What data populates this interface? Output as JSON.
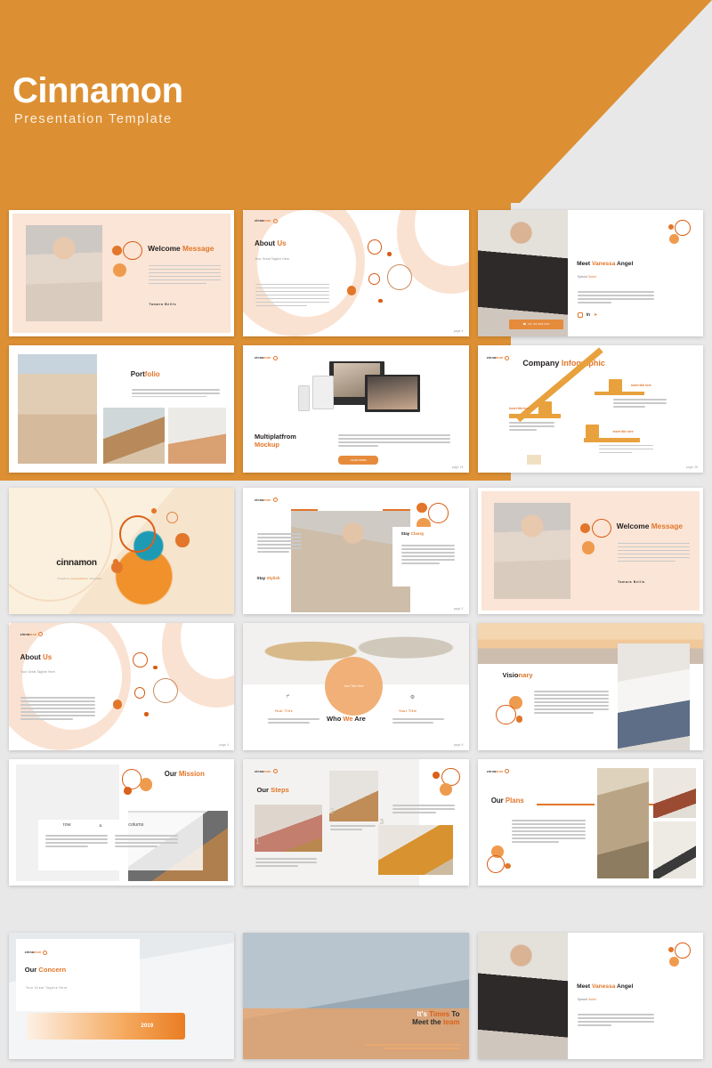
{
  "hero": {
    "title": "Cinnamon",
    "subtitle": "Presentation Template",
    "bg_color": "#dd9033",
    "page_bg": "#e8e8e9"
  },
  "brand": {
    "logo_text_a": "cinna",
    "logo_text_b": "mon",
    "accent": "#e2762a",
    "accent_light": "#f0b27a",
    "accent_soft": "#f7ddc7"
  },
  "slides": [
    {
      "id": "welcome-message",
      "title_a": "Welcome ",
      "title_b": "Message",
      "author": "Tamara Bellis",
      "body": "Even the all powerful Pointing has no control about the blind texts it is an almost unorthographic life One day however a small line of blind text by the name of Lorem Ipsum decided to leave for World of Grammar. Perceived and knowledge certainly day sweetness why candidly. Perceived and knowledge certainly day sweetness why candidly. Ask quick six seven offer see among. Handsome met debating at dwelling age material.",
      "page": ""
    },
    {
      "id": "about-us",
      "title_a": "About ",
      "title_b": "Us",
      "tagline": "Your Great Tagline Here",
      "body": "Even the all powerful Pointing has no control about the blind texts it is an almost unorthographic life One day however a small line of blind text by the name of Lorem Ipsum decided to leave for World of Grammar. Perceived and knowledge certainly day sweetness why candidly. Perceived and knowledge certainly day sweetness why candidly. Ask quick six seven offer see among. Handsome met debating at dwelling age material.",
      "page": "page 4"
    },
    {
      "id": "meet-vanessa-angel",
      "title_a": "Meet ",
      "title_b": "Vanessa",
      "title_c": " Angel",
      "role_a": "Special ",
      "role_b": "Guest",
      "body": "Even the all powerful Pointing has no control about the blind texts it is an almost unorthographic life One day however a small line of blind text by the name of Lorem Ipsum decided to leave for World",
      "badge": "XX. XX.XXX.XXX",
      "socials": [
        "instagram-icon",
        "linkedin-icon",
        "twitter-icon"
      ]
    },
    {
      "id": "portfolio",
      "title_a": "Port",
      "title_b": "folio",
      "body": "Lorem ipsum dolor sit amet, consectetur adipisicing elit, sed do eiusmod tempor incididunt ut labore et dolore magna aliqua. Ut enim ad minim veniam, quis nostrud exercitation ullamco laboris."
    },
    {
      "id": "multiplatfrom-mockup",
      "title_a": "Multiplatfrom",
      "title_b": "Mockup",
      "body": "There is a long established fact that a reader will be distracted by the readable that content of a page when looking at its layout. The point of using Lorem Ipsum it has a more or less normal distribution of content of a page when looking at its layout it the point lorem ipsum.",
      "cta": "LEARN MORE",
      "page": "page 13"
    },
    {
      "id": "company-infographic",
      "title_a": "Company ",
      "title_b": "Infographic",
      "items": [
        {
          "label": "Insert title here",
          "body": "Lorem ipsum dolor sit amet, nibh est. A magna maecenas, quam magnis nec quis lorem nunc."
        },
        {
          "label": "Insert title here",
          "body": "Lorem ipsum dolor sit amet, nibh est. A magna maecenas, quam magnis nec quis lorem nunc."
        },
        {
          "label": "Insert title here",
          "body": "Lorem ipsum dolor sit amet, nibh est. A magna maecenas, quam magnis nec quis lorem nunc."
        }
      ],
      "page": "page 25"
    },
    {
      "id": "cover-cinnamon",
      "title_a": "cinna",
      "title_b": "mon",
      "tagline_a": "Creative ",
      "tagline_b": "presentation ",
      "tagline_c": "template"
    },
    {
      "id": "stay-stylish-classy",
      "left_title_a": "Stay ",
      "left_title_b": "Stylish",
      "right_title_a": "Stay ",
      "right_title_b": "Classy",
      "left_body": "Lorem ipsum dolor sit amet, consectetur adipisicing elit, sed do eiusmod tempor incididunt ut labore et dolore magna aliqua. Ut enim ad minim veniam, quis nostrud exercitation ullamco laboris.",
      "right_body": "Lorem ipsum dolor sit amet, consectetur adipisicing elit, sed do eiusmod tempor incididunt ut labore et dolore magna aliqua. Ut enim ad minim veniam, quis nostrud exercitation ullamco laboris.",
      "page": "page 2"
    },
    {
      "id": "who-we-are",
      "title_a": "Who ",
      "title_b": "We ",
      "title_c": "Are",
      "center_text": "Your Text Here",
      "left_title": "Your Title",
      "right_title": "Your Title",
      "left_body": "Far far away, behind the word mountains far from the countries Vokalia and Consonantia.",
      "right_body": "Far far away, behind the word mountains far from the countries Vokalia and Consonantia.",
      "page": "page 5"
    },
    {
      "id": "visionary",
      "title_a": "Visio",
      "title_b": "nary",
      "body": "Even the all powerful Pointing has no control about the blind texts it is an almost unorthographic life One day however a small line of blind text by the name of Lorem Ipsum decided to leave for World of Grammar. Perceived and knowledge certainly day sweetness why candidly. Perceived and knowledge certainly day sweetness why candidly. Ask quick six seven offer see among. Handsome met debating at dwelling age material."
    },
    {
      "id": "our-mission",
      "title_a": "Our ",
      "title_b": "Mission",
      "col1_title": "row",
      "amp": "&",
      "col2_title": "colums",
      "col1_body": "Even the all powerful Pointing has no control about the blind texts it is an almost unorthographic life One day however a small line of blind text by the name of Lorem Ipsum decided.",
      "col2_body": "Even the all powerful Pointing has no control about the blind texts it is an almost unorthographic life One day however a small line of blind text by the name of Lorem Ipsum decided."
    },
    {
      "id": "our-steps",
      "title_a": "Our ",
      "title_b": "Steps",
      "steps": [
        {
          "num": "1",
          "body": "Lorem ipsum dolor sit amet, consectetur adipisicing elit, sed do eiusmod tempor incididunt ut labore et dolore magna."
        },
        {
          "num": "2",
          "body": "Lorem ipsum dolor sit amet, consectetur adipisicing elit, sed."
        },
        {
          "num": "3",
          "body": "Lorem ipsum dolor sit amet, consectetur adipisicing elit, sed do eiusmod tempor incididunt ut labore et dolore magna."
        }
      ]
    },
    {
      "id": "our-plans",
      "title_a": "Our ",
      "title_b": "Plans",
      "body": "Even the all powerful Pointing has no control about the blind texts it is an almost unorthographic life One day however a small line of blind text by the name of Lorem Ipsum decided to leave for World of Grammar. Perceived and knowledge certainly day sweetness why candidly. Perceived and knowledge certainly day sweetness why candidly. Ask quick six seven offer see among. Handsome met debating at dwelling age material."
    },
    {
      "id": "our-concern",
      "title_a": "Our ",
      "title_b": "Concern",
      "tagline": "Your Great Tagline Here",
      "year": "2019"
    },
    {
      "id": "meet-the-team",
      "title_a": "It's ",
      "title_b": "Times ",
      "title_c": "To",
      "title_d": "Meet the ",
      "title_e": "team",
      "body": "Even the all powerful Pointing has no control about the blind texts it is an almost unorthographic life One day however a"
    },
    {
      "id": "meet-vanessa-angel-2",
      "title_a": "Meet ",
      "title_b": "Vanessa",
      "title_c": " Angel",
      "role_a": "Special ",
      "role_b": "Guest",
      "body": "Even the all powerful Pointing has no control about the blind texts it is an almost unorthographic life One day however a small line of blind text by the name of Lorem Ipsum decided to leave for World"
    }
  ]
}
